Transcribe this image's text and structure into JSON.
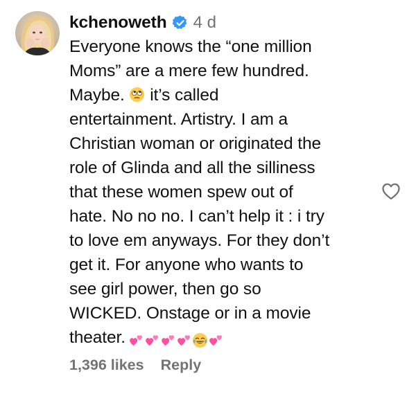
{
  "comment": {
    "username": "kchenoweth",
    "verified": true,
    "timestamp": "4 d",
    "lines": [
      "Everyone knows the “one million",
      "Moms” are a mere few hundred.",
      "it’s called",
      "entertainment. Artistry. I am a",
      "Christian woman or originated the",
      "role of Glinda and all the silliness",
      "that these women spew out of",
      "hate. No no no. I can’t help it : i try",
      "to love em anyways. For they don’t",
      "get it. For anyone who wants to",
      "see girl power, then go so",
      "WICKED. Onstage or in a movie",
      "theater."
    ],
    "line3_prefix": "Maybe.",
    "emojis": {
      "inline": "face-with-rolling-eyes-emoji",
      "trailing": [
        "two-hearts-emoji",
        "two-hearts-emoji",
        "two-hearts-emoji",
        "two-hearts-emoji",
        "face-with-tears-of-joy-emoji",
        "two-hearts-emoji"
      ]
    },
    "likes": "1,396 likes",
    "reply_label": "Reply"
  },
  "colors": {
    "text": "#111111",
    "muted": "#737373",
    "verified_blue": "#3897f0",
    "heart_pink": "#ff4fa0",
    "like_outline": "#737373"
  },
  "icons": {
    "verified": "verified-badge-icon",
    "like": "heart-outline-icon"
  }
}
